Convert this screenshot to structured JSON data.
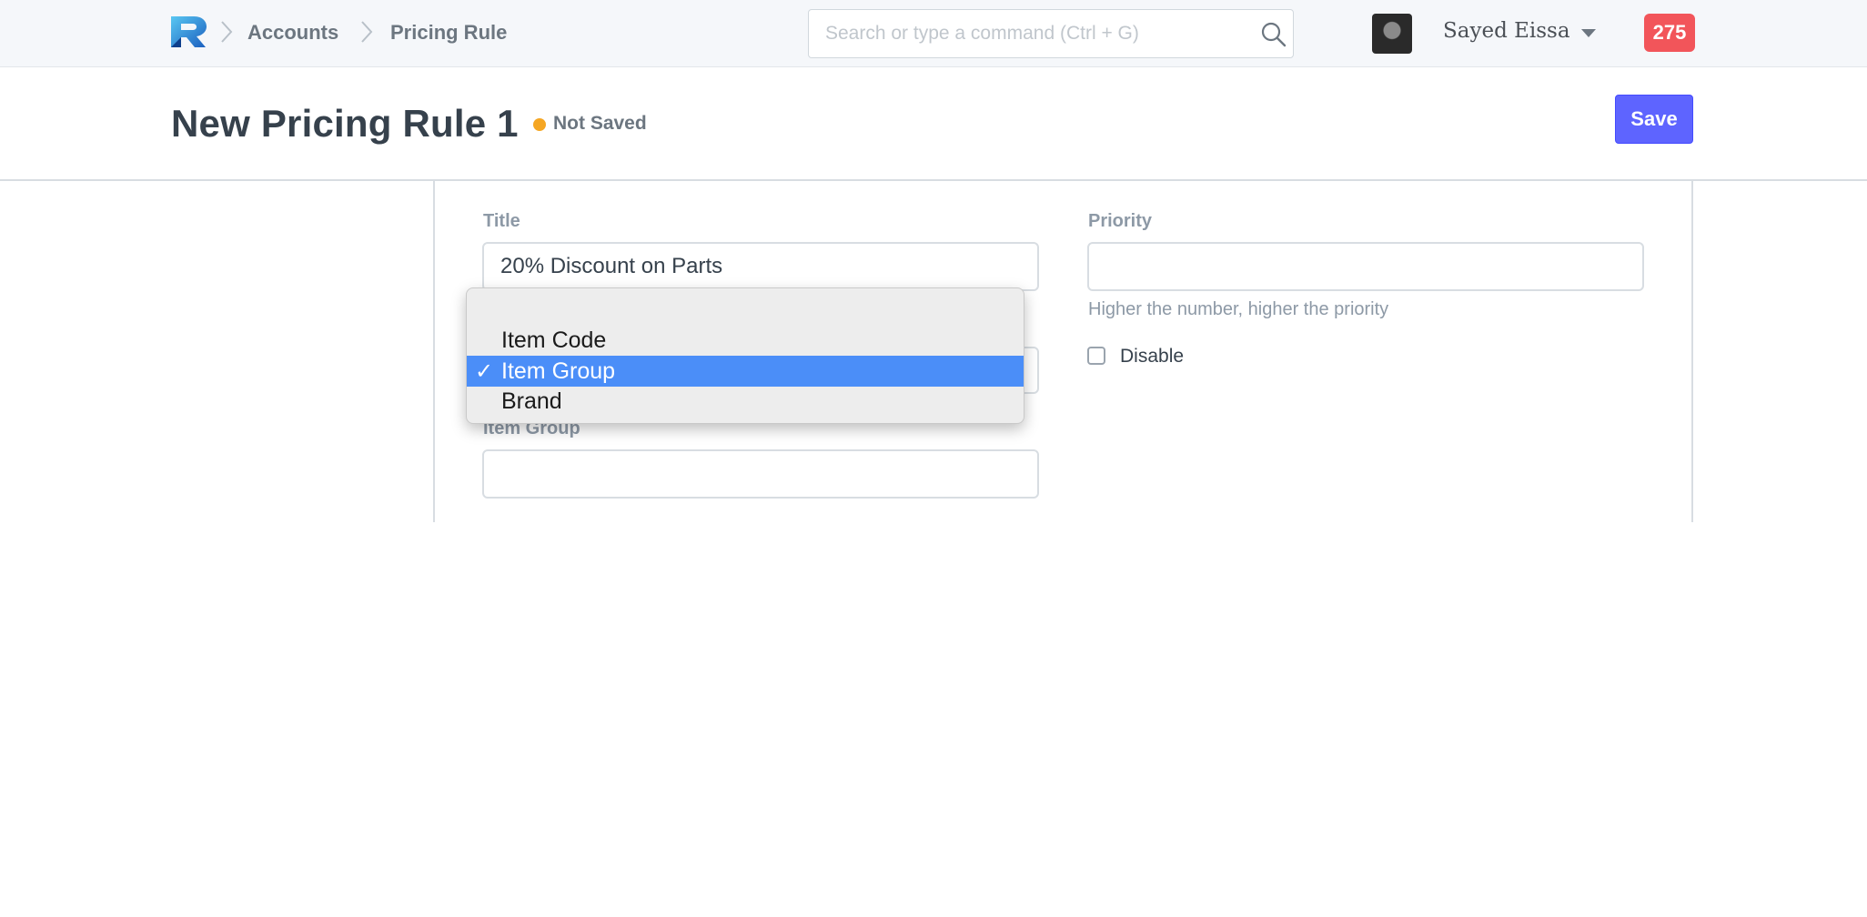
{
  "navbar": {
    "breadcrumbs": [
      "Accounts",
      "Pricing Rule"
    ],
    "search_placeholder": "Search or type a command (Ctrl + G)",
    "user_name": "Sayed Eissa",
    "notification_count": "275"
  },
  "page_head": {
    "title": "New Pricing Rule 1",
    "status": "Not Saved",
    "status_color": "#f5a623",
    "save_label": "Save",
    "save_color": "#5e64ff"
  },
  "form": {
    "title_label": "Title",
    "title_value": "20% Discount on Parts",
    "priority_label": "Priority",
    "priority_value": "",
    "priority_help": "Higher the number, higher the priority",
    "disable_label": "Disable",
    "disable_checked": false,
    "apply_on_field_label": "Item Group",
    "apply_on_field_value": ""
  },
  "dropdown": {
    "options": [
      "",
      "Item Code",
      "Item Group",
      "Brand"
    ],
    "selected": "Item Group",
    "check_mark": "✓",
    "highlight_color": "#4b8ef8"
  },
  "icons": {
    "logo": "r-logo-icon",
    "breadcrumb_separator": "chevron-right-icon",
    "search": "search-icon",
    "user_menu": "caret-down-icon",
    "selected_option": "checkmark-icon"
  }
}
